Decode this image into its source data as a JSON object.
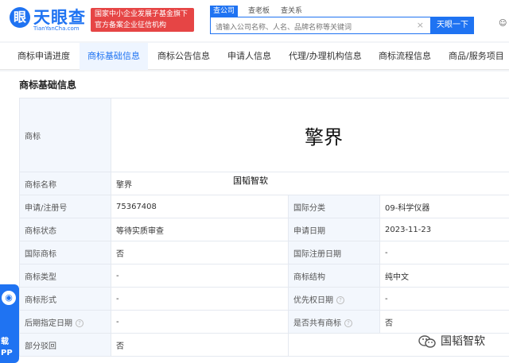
{
  "header": {
    "logo_text": "天眼查",
    "logo_sub": "TianYanCha.com",
    "gov_badge_line1": "国家中小企业发展子基金旗下",
    "gov_badge_line2": "官方备案企业征信机构",
    "search_tabs": [
      "查公司",
      "查老板",
      "查关系"
    ],
    "search_placeholder": "请输入公司名称、人名、品牌名称等关键词",
    "search_button": "天眼一下"
  },
  "nav": {
    "items": [
      "商标申请进度",
      "商标基础信息",
      "商标公告信息",
      "申请人信息",
      "代理/办理机构信息",
      "商标流程信息",
      "商品/服务项目"
    ],
    "active_index": 1
  },
  "section_title": "商标基础信息",
  "trademark_image_text": "擎界",
  "watermark_text": "国韬智软",
  "rows": {
    "trademark_label": "商标",
    "name_label": "商标名称",
    "name_value": "擎界",
    "reg_no_label": "申请/注册号",
    "reg_no_value": "75367408",
    "intl_class_label": "国际分类",
    "intl_class_value": "09-科学仪器",
    "status_label": "商标状态",
    "status_value": "等待实质审查",
    "apply_date_label": "申请日期",
    "apply_date_value": "2023-11-23",
    "intl_mark_label": "国际商标",
    "intl_mark_value": "否",
    "intl_reg_date_label": "国际注册日期",
    "intl_reg_date_value": "-",
    "type_label": "商标类型",
    "type_value": "-",
    "structure_label": "商标结构",
    "structure_value": "纯中文",
    "form_label": "商标形式",
    "form_value": "-",
    "priority_date_label": "优先权日期",
    "priority_date_value": "-",
    "later_date_label": "后期指定日期",
    "later_date_value": "-",
    "shared_label": "是否共有商标",
    "shared_value": "否",
    "partial_reject_label": "部分驳回",
    "partial_reject_value": "否"
  },
  "side_app": {
    "line1": "载",
    "line2": "PP"
  },
  "wechat_account": "国韬智软",
  "colors": {
    "brand": "#1f73f2",
    "badge_red": "#e64545",
    "label_bg": "#f3f7fd"
  }
}
